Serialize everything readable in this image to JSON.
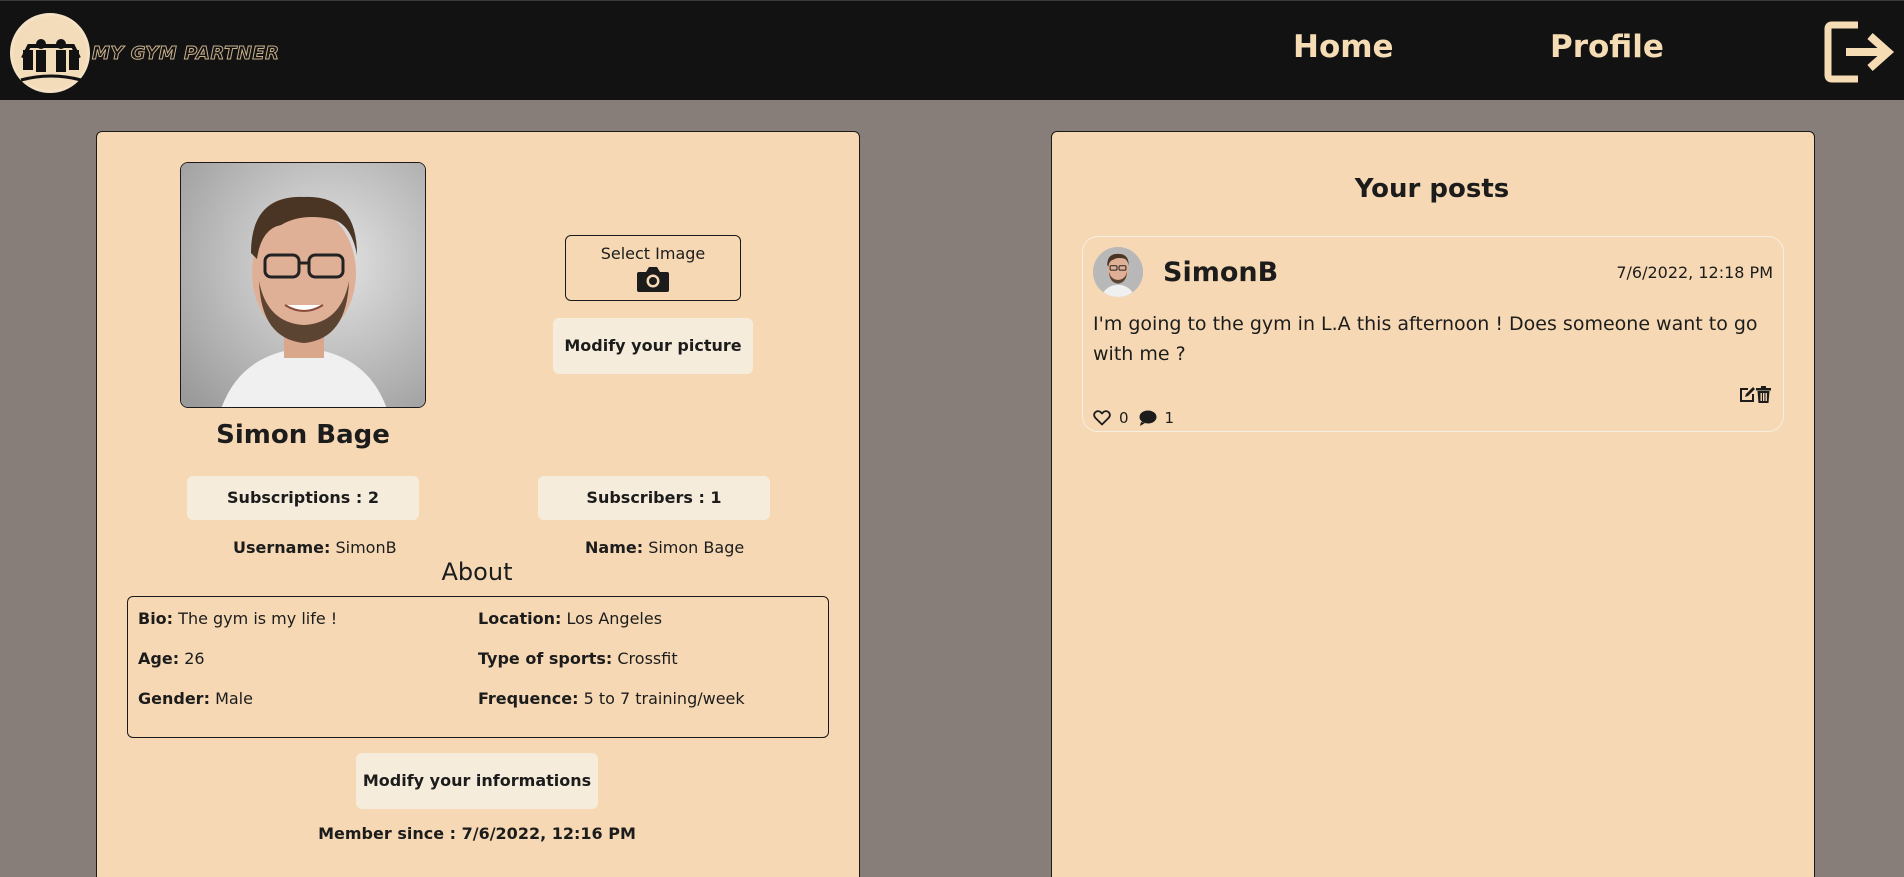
{
  "nav": {
    "logo_text": "MY GYM PARTNER",
    "home": "Home",
    "profile": "Profile",
    "logout_icon": "logout-icon"
  },
  "profile": {
    "full_name": "Simon Bage",
    "select_image": "Select Image",
    "modify_picture": "Modify your picture",
    "subscriptions": "Subscriptions : 2",
    "subscribers": "Subscribers : 1",
    "username_label": "Username:",
    "username": "SimonB",
    "name_label": "Name:",
    "name": "Simon Bage",
    "about_title": "About",
    "about": {
      "bio_label": "Bio:",
      "bio": "The gym is my life !",
      "age_label": "Age:",
      "age": "26",
      "gender_label": "Gender:",
      "gender": "Male",
      "location_label": "Location:",
      "location": "Los Angeles",
      "sports_label": "Type of sports:",
      "sports": "Crossfit",
      "frequence_label": "Frequence:",
      "frequence": "5 to 7 training/week"
    },
    "modify_info": "Modify your informations",
    "member_since": "Member since : 7/6/2022, 12:16 PM"
  },
  "posts": {
    "title": "Your posts",
    "items": [
      {
        "user": "SimonB",
        "date": "7/6/2022, 12:18 PM",
        "text": "I'm going to the gym in L.A this afternoon ! Does someone want to go with me ?",
        "likes": "0",
        "comments": "1"
      }
    ]
  },
  "colors": {
    "navbar": "#121212",
    "background": "#877e7a",
    "card": "#f6d9b4",
    "accent": "#f5dcb4",
    "button": "#f6ecdb"
  }
}
